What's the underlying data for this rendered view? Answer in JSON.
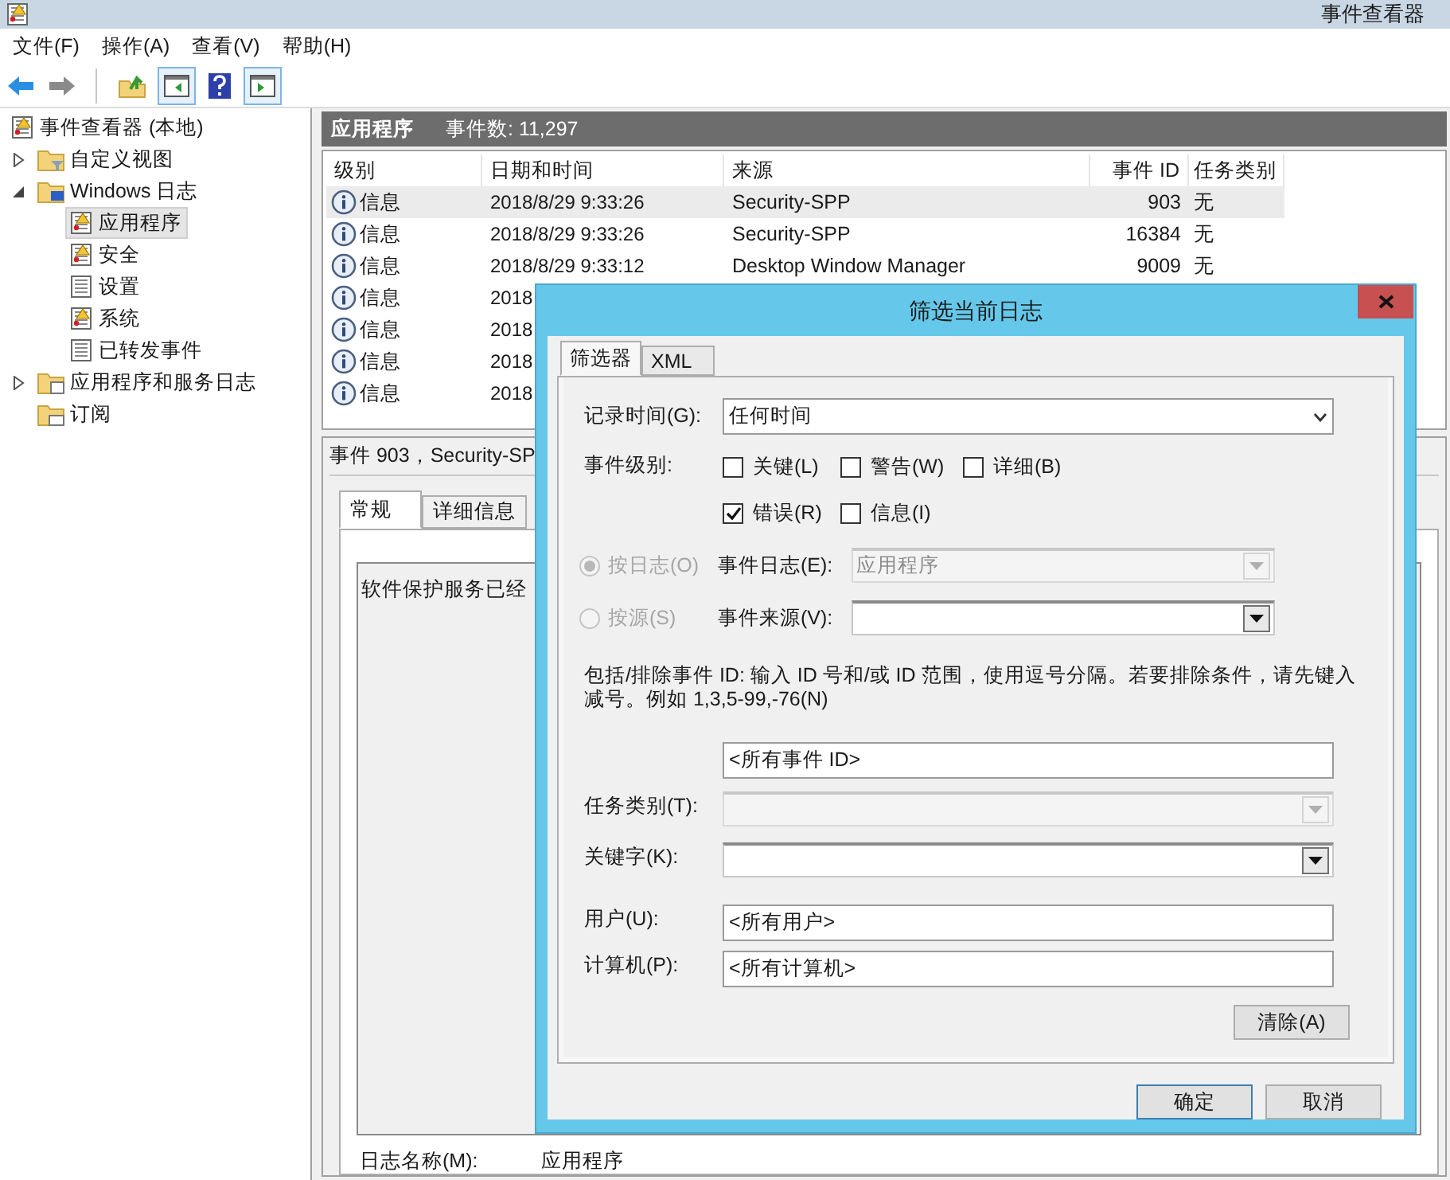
{
  "window": {
    "title": "事件查看器"
  },
  "menu": [
    {
      "label": "文件(F)"
    },
    {
      "label": "操作(A)"
    },
    {
      "label": "查看(V)"
    },
    {
      "label": "帮助(H)"
    }
  ],
  "toolbar": [
    {
      "kind": "back",
      "disabled": false
    },
    {
      "kind": "forward",
      "disabled": true
    },
    {
      "kind": "separator"
    },
    {
      "kind": "up",
      "disabled": false
    },
    {
      "kind": "pane",
      "disabled": false
    },
    {
      "kind": "help",
      "disabled": false
    },
    {
      "kind": "pane2",
      "disabled": false
    }
  ],
  "tree": [
    {
      "label": "事件查看器 (本地)",
      "kind": "log-alert",
      "selected": false,
      "children": [
        {
          "label": "自定义视图",
          "kind": "folder-filter",
          "expanded": false,
          "selected": false
        },
        {
          "label": "Windows 日志",
          "kind": "folder-monitor",
          "expanded": true,
          "selected": false,
          "children": [
            {
              "label": "应用程序",
              "kind": "log-alert",
              "selected": true
            },
            {
              "label": "安全",
              "kind": "log-alert",
              "selected": false
            },
            {
              "label": "设置",
              "kind": "log",
              "selected": false
            },
            {
              "label": "系统",
              "kind": "log-alert",
              "selected": false
            },
            {
              "label": "已转发事件",
              "kind": "log",
              "selected": false
            }
          ]
        },
        {
          "label": "应用程序和服务日志",
          "kind": "folder-log",
          "expanded": false,
          "selected": false
        },
        {
          "label": "订阅",
          "kind": "folder-sub",
          "selected": false
        }
      ]
    }
  ],
  "log_header": {
    "name": "应用程序",
    "count": "事件数: 11,297"
  },
  "table": {
    "columns": [
      "级别",
      "日期和时间",
      "来源",
      "事件 ID",
      "任务类别"
    ],
    "rows": [
      {
        "level": "信息",
        "datetime": "2018/8/29 9:33:26",
        "source": "Security-SPP",
        "event_id": "903",
        "task_category": "无",
        "selected": true
      },
      {
        "level": "信息",
        "datetime": "2018/8/29 9:33:26",
        "source": "Security-SPP",
        "event_id": "16384",
        "task_category": "无",
        "selected": false
      },
      {
        "level": "信息",
        "datetime": "2018/8/29 9:33:12",
        "source": "Desktop Window Manager",
        "event_id": "9009",
        "task_category": "无",
        "selected": false
      },
      {
        "level": "信息",
        "datetime": "2018",
        "selected": false
      },
      {
        "level": "信息",
        "datetime": "2018",
        "selected": false
      },
      {
        "level": "信息",
        "datetime": "2018",
        "selected": false
      },
      {
        "level": "信息",
        "datetime": "2018",
        "selected": false
      }
    ]
  },
  "details": {
    "title": "事件 903，Security-SP",
    "tabs": [
      {
        "label": "常规",
        "selected": true
      },
      {
        "label": "详细信息",
        "selected": false
      }
    ],
    "message": "软件保护服务已经",
    "log_name": {
      "label": "日志名称(M):",
      "value": "应用程序"
    }
  },
  "dialog": {
    "title": "筛选当前日志",
    "tabs": [
      {
        "label": "筛选器",
        "selected": true
      },
      {
        "label": "XML",
        "selected": false
      }
    ],
    "logged": {
      "label": "记录时间(G):",
      "value": "任何时间"
    },
    "levels": {
      "label": "事件级别:",
      "options": [
        {
          "label": "关键(L)",
          "checked": false
        },
        {
          "label": "警告(W)",
          "checked": false
        },
        {
          "label": "详细(B)",
          "checked": false
        },
        {
          "label": "错误(R)",
          "checked": true
        },
        {
          "label": "信息(I)",
          "checked": false
        }
      ]
    },
    "by": [
      {
        "label": "按日志(O)",
        "selected": true,
        "disabled": true,
        "field": {
          "label": "事件日志(E):",
          "value": "应用程序",
          "disabled": true
        }
      },
      {
        "label": "按源(S)",
        "selected": false,
        "disabled": true,
        "field": {
          "label": "事件来源(V):",
          "disabled": false
        }
      }
    ],
    "hint": "包括/排除事件 ID: 输入 ID 号和/或 ID 范围，使用逗号分隔。若要排除条件，请先键入减号。例如 1,3,5-99,-76(N)",
    "event_ids": {
      "value": "<所有事件 ID>"
    },
    "task_category": {
      "label": "任务类别(T):",
      "disabled": true
    },
    "keywords": {
      "label": "关键字(K):",
      "disabled": false
    },
    "user": {
      "label": "用户(U):",
      "value": "<所有用户>"
    },
    "computer": {
      "label": "计算机(P):",
      "value": "<所有计算机>"
    },
    "clear_button": "清除(A)",
    "buttons": [
      "确定",
      "取消"
    ]
  }
}
